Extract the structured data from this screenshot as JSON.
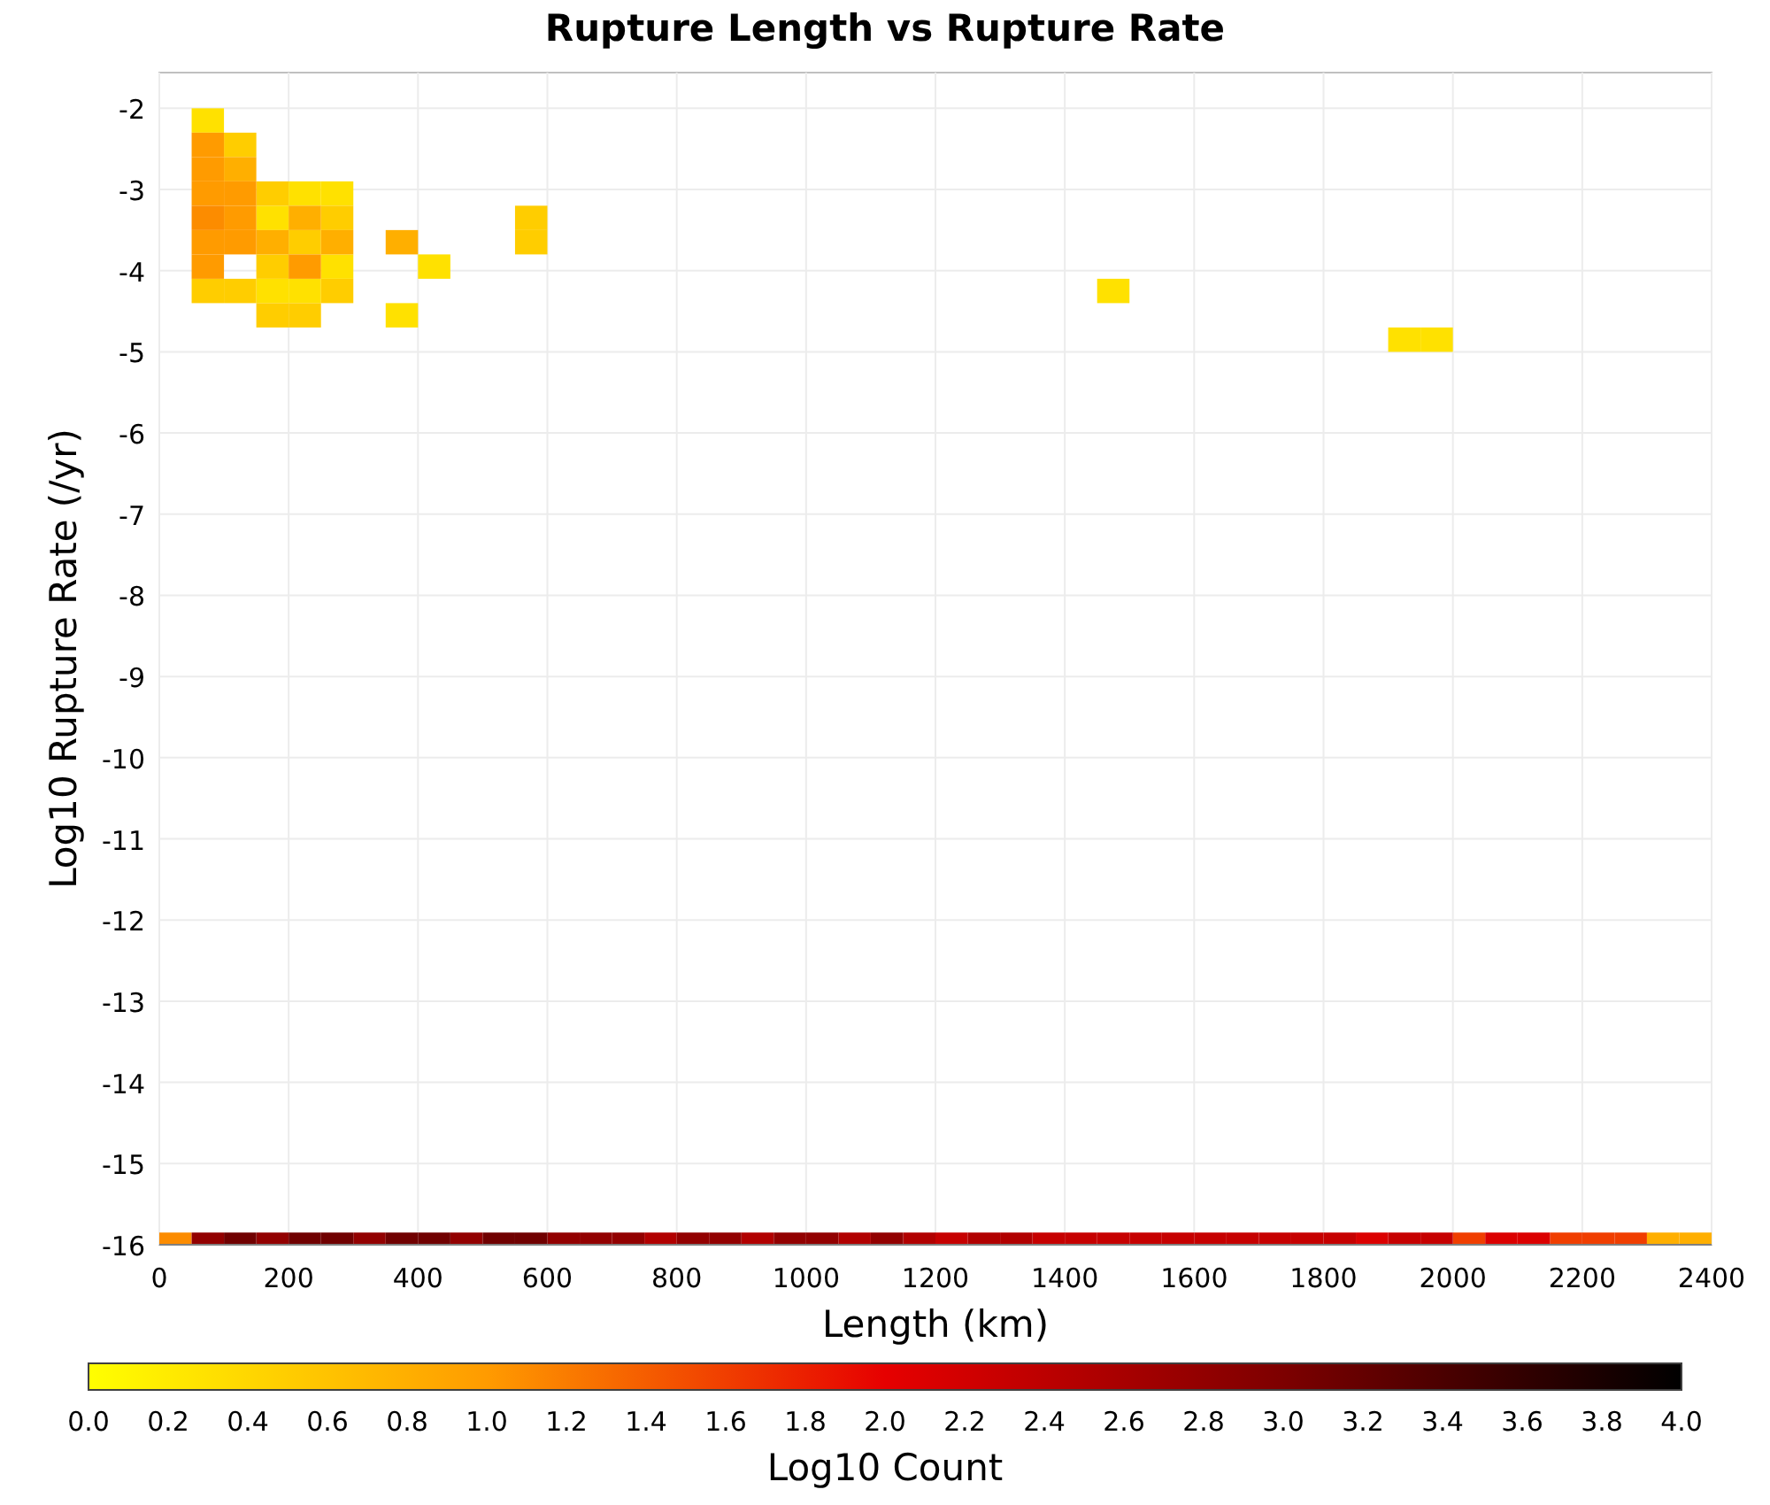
{
  "chart_data": {
    "type": "scatter",
    "title": "Rupture Length vs Rupture Rate",
    "xlabel": "Length (km)",
    "ylabel": "Log10 Rupture Rate (/yr)",
    "xlim": [
      0,
      2400
    ],
    "ylim": [
      -16,
      -1.56
    ],
    "grid": true,
    "xticks": [
      0,
      200,
      400,
      600,
      800,
      1000,
      1200,
      1400,
      1600,
      1800,
      2000,
      2200,
      2400
    ],
    "yticks": [
      -2,
      -3,
      -4,
      -5,
      -6,
      -7,
      -8,
      -9,
      -10,
      -11,
      -12,
      -13,
      -14,
      -15,
      -16
    ],
    "x": [
      75,
      225,
      275,
      175,
      275,
      425,
      175,
      225,
      1475,
      375,
      1925,
      1975,
      125,
      175,
      275,
      575,
      575,
      75,
      125,
      275,
      175,
      225,
      225,
      175,
      125,
      225,
      175,
      275,
      375,
      2325,
      2375,
      75,
      75,
      75,
      125,
      125,
      75,
      125,
      75,
      225,
      75,
      25,
      2025,
      2175,
      2225,
      2275,
      1875,
      2075,
      2125,
      1225,
      1375,
      1425,
      1475,
      1525,
      1575,
      1625,
      1675,
      1725,
      1775,
      1825,
      1925,
      1975,
      925,
      1075,
      1175,
      1275,
      1325,
      775,
      625,
      975,
      1125,
      675,
      725,
      825,
      875,
      475,
      175,
      1025,
      325,
      75,
      125,
      225,
      275,
      375,
      425,
      525,
      575
    ],
    "series": [
      {
        "color": "#ffe100",
        "values": [
          -2.15,
          -3.05,
          -3.05,
          -3.35,
          -3.95,
          -3.95,
          -4.25,
          -4.25,
          -4.25,
          -4.55,
          -4.85,
          -4.85,
          null,
          null,
          null,
          null,
          null,
          null,
          null,
          null,
          null,
          null,
          null,
          null,
          null,
          null,
          null,
          null,
          null,
          null,
          null,
          null,
          null,
          null,
          null,
          null,
          null,
          null,
          null,
          null,
          null,
          null,
          null,
          null,
          null,
          null,
          null,
          null,
          null,
          null,
          null,
          null,
          null,
          null,
          null,
          null,
          null,
          null,
          null,
          null,
          null,
          null,
          null,
          null,
          null,
          null,
          null,
          null,
          null,
          null,
          null,
          null,
          null,
          null,
          null,
          null,
          null,
          null,
          null,
          null,
          null,
          null,
          null,
          null,
          null,
          null,
          null
        ]
      },
      {
        "color": "#ffcd00",
        "values": [
          null,
          null,
          null,
          null,
          null,
          null,
          null,
          null,
          null,
          null,
          null,
          null,
          -2.45,
          -3.05,
          -3.35,
          -3.35,
          -3.65,
          -4.25,
          -4.25,
          -4.25,
          -4.55,
          -4.55,
          -3.65,
          -3.95,
          null,
          null,
          null,
          null,
          null,
          null,
          null,
          null,
          null,
          null,
          null,
          null,
          null,
          null,
          null,
          null,
          null,
          null,
          null,
          null,
          null,
          null,
          null,
          null,
          null,
          null,
          null,
          null,
          null,
          null,
          null,
          null,
          null,
          null,
          null,
          null,
          null,
          null,
          null,
          null,
          null,
          null,
          null,
          null,
          null,
          null,
          null,
          null,
          null,
          null,
          null,
          null,
          null,
          null,
          null,
          null,
          null,
          null,
          null,
          null,
          null,
          null,
          null
        ]
      },
      {
        "color": "#ffaf00",
        "values": [
          null,
          null,
          null,
          null,
          null,
          null,
          null,
          null,
          null,
          null,
          null,
          null,
          null,
          null,
          null,
          null,
          null,
          null,
          null,
          null,
          null,
          null,
          null,
          null,
          -2.75,
          -3.35,
          -3.65,
          -3.65,
          -3.65,
          -16,
          -16,
          null,
          null,
          null,
          null,
          null,
          null,
          null,
          null,
          null,
          null,
          null,
          null,
          null,
          null,
          null,
          null,
          null,
          null,
          null,
          null,
          null,
          null,
          null,
          null,
          null,
          null,
          null,
          null,
          null,
          null,
          null,
          null,
          null,
          null,
          null,
          null,
          null,
          null,
          null,
          null,
          null,
          null,
          null,
          null,
          null,
          null,
          null,
          null,
          null,
          null,
          null,
          null,
          null,
          null,
          null,
          null
        ]
      },
      {
        "color": "#ff9b00",
        "values": [
          null,
          null,
          null,
          null,
          null,
          null,
          null,
          null,
          null,
          null,
          null,
          null,
          null,
          null,
          null,
          null,
          null,
          null,
          null,
          null,
          null,
          null,
          null,
          null,
          null,
          null,
          null,
          null,
          null,
          null,
          null,
          -2.45,
          -2.75,
          -3.05,
          -3.05,
          -3.35,
          -3.65,
          -3.65,
          -3.95,
          -3.95,
          null,
          null,
          null,
          null,
          null,
          null,
          null,
          null,
          null,
          null,
          null,
          null,
          null,
          null,
          null,
          null,
          null,
          null,
          null,
          null,
          null,
          null,
          null,
          null,
          null,
          null,
          null,
          null,
          null,
          null,
          null,
          null,
          null,
          null,
          null,
          null,
          null,
          null,
          null,
          null,
          null,
          null,
          null,
          null,
          null,
          null,
          null
        ]
      },
      {
        "color": "#fc8c00",
        "values": [
          null,
          null,
          null,
          null,
          null,
          null,
          null,
          null,
          null,
          null,
          null,
          null,
          null,
          null,
          null,
          null,
          null,
          null,
          null,
          null,
          null,
          null,
          null,
          null,
          null,
          null,
          null,
          null,
          null,
          null,
          null,
          null,
          null,
          null,
          null,
          null,
          null,
          null,
          null,
          null,
          -3.35,
          -16,
          null,
          null,
          null,
          null,
          null,
          null,
          null,
          null,
          null,
          null,
          null,
          null,
          null,
          null,
          null,
          null,
          null,
          null,
          null,
          null,
          null,
          null,
          null,
          null,
          null,
          null,
          null,
          null,
          null,
          null,
          null,
          null,
          null,
          null,
          null,
          null,
          null,
          null,
          null,
          null,
          null,
          null,
          null,
          null,
          null
        ]
      },
      {
        "color": "#f03e00",
        "values": [
          null,
          null,
          null,
          null,
          null,
          null,
          null,
          null,
          null,
          null,
          null,
          null,
          null,
          null,
          null,
          null,
          null,
          null,
          null,
          null,
          null,
          null,
          null,
          null,
          null,
          null,
          null,
          null,
          null,
          null,
          null,
          null,
          null,
          null,
          null,
          null,
          null,
          null,
          null,
          null,
          null,
          null,
          -16,
          -16,
          -16,
          -16,
          null,
          null,
          null,
          null,
          null,
          null,
          null,
          null,
          null,
          null,
          null,
          null,
          null,
          null,
          null,
          null,
          null,
          null,
          null,
          null,
          null,
          null,
          null,
          null,
          null,
          null,
          null,
          null,
          null,
          null,
          null,
          null,
          null,
          null,
          null,
          null,
          null,
          null,
          null,
          null,
          null
        ]
      },
      {
        "color": "#db0000",
        "values": [
          null,
          null,
          null,
          null,
          null,
          null,
          null,
          null,
          null,
          null,
          null,
          null,
          null,
          null,
          null,
          null,
          null,
          null,
          null,
          null,
          null,
          null,
          null,
          null,
          null,
          null,
          null,
          null,
          null,
          null,
          null,
          null,
          null,
          null,
          null,
          null,
          null,
          null,
          null,
          null,
          null,
          null,
          null,
          null,
          null,
          null,
          -16,
          -16,
          -16,
          null,
          null,
          null,
          null,
          null,
          null,
          null,
          null,
          null,
          null,
          null,
          null,
          null,
          null,
          null,
          null,
          null,
          null,
          null,
          null,
          null,
          null,
          null,
          null,
          null,
          null,
          null,
          null,
          null,
          null,
          null,
          null,
          null,
          null,
          null,
          null,
          null,
          null
        ]
      },
      {
        "color": "#c60000",
        "values": [
          null,
          null,
          null,
          null,
          null,
          null,
          null,
          null,
          null,
          null,
          null,
          null,
          null,
          null,
          null,
          null,
          null,
          null,
          null,
          null,
          null,
          null,
          null,
          null,
          null,
          null,
          null,
          null,
          null,
          null,
          null,
          null,
          null,
          null,
          null,
          null,
          null,
          null,
          null,
          null,
          null,
          null,
          null,
          null,
          null,
          null,
          null,
          null,
          null,
          -16,
          -16,
          -16,
          -16,
          -16,
          -16,
          -16,
          -16,
          -16,
          -16,
          -16,
          -16,
          -16,
          null,
          null,
          null,
          null,
          null,
          null,
          null,
          null,
          null,
          null,
          null,
          null,
          null,
          null,
          null,
          null,
          null,
          null,
          null,
          null,
          null,
          null,
          null,
          null,
          null
        ]
      },
      {
        "color": "#b10000",
        "values": [
          null,
          null,
          null,
          null,
          null,
          null,
          null,
          null,
          null,
          null,
          null,
          null,
          null,
          null,
          null,
          null,
          null,
          null,
          null,
          null,
          null,
          null,
          null,
          null,
          null,
          null,
          null,
          null,
          null,
          null,
          null,
          null,
          null,
          null,
          null,
          null,
          null,
          null,
          null,
          null,
          null,
          null,
          null,
          null,
          null,
          null,
          null,
          null,
          null,
          null,
          null,
          null,
          null,
          null,
          null,
          null,
          null,
          null,
          null,
          null,
          null,
          null,
          -16,
          -16,
          -16,
          -16,
          -16,
          -16,
          null,
          null,
          null,
          null,
          null,
          null,
          null,
          null,
          null,
          null,
          null,
          null,
          null,
          null,
          null,
          null,
          null,
          null,
          null
        ]
      },
      {
        "color": "#920000",
        "values": [
          null,
          null,
          null,
          null,
          null,
          null,
          null,
          null,
          null,
          null,
          null,
          null,
          null,
          null,
          null,
          null,
          null,
          null,
          null,
          null,
          null,
          null,
          null,
          null,
          null,
          null,
          null,
          null,
          null,
          null,
          null,
          null,
          null,
          null,
          null,
          null,
          null,
          null,
          null,
          null,
          null,
          null,
          null,
          null,
          null,
          null,
          null,
          null,
          null,
          null,
          null,
          null,
          null,
          null,
          null,
          null,
          null,
          null,
          null,
          null,
          null,
          null,
          null,
          null,
          null,
          null,
          null,
          null,
          -16,
          -16,
          -16,
          -16,
          -16,
          -16,
          -16,
          -16,
          -16,
          -16,
          -16,
          -16,
          null,
          null,
          null,
          null,
          null,
          null,
          null
        ]
      },
      {
        "color": "#700000",
        "values": [
          null,
          null,
          null,
          null,
          null,
          null,
          null,
          null,
          null,
          null,
          null,
          null,
          null,
          null,
          null,
          null,
          null,
          null,
          null,
          null,
          null,
          null,
          null,
          null,
          null,
          null,
          null,
          null,
          null,
          null,
          null,
          null,
          null,
          null,
          null,
          null,
          null,
          null,
          null,
          null,
          null,
          null,
          null,
          null,
          null,
          null,
          null,
          null,
          null,
          null,
          null,
          null,
          null,
          null,
          null,
          null,
          null,
          null,
          null,
          null,
          null,
          null,
          null,
          null,
          null,
          null,
          null,
          null,
          null,
          null,
          null,
          null,
          null,
          null,
          null,
          null,
          null,
          null,
          null,
          null,
          -16,
          -16,
          -16,
          -16,
          -16,
          -16,
          -16
        ]
      }
    ]
  },
  "colorbar": {
    "label": "Log10 Count",
    "ticks": [
      "0.0",
      "0.2",
      "0.4",
      "0.6",
      "0.8",
      "1.0",
      "1.2",
      "1.4",
      "1.6",
      "1.8",
      "2.0",
      "2.2",
      "2.4",
      "2.6",
      "2.8",
      "3.0",
      "3.2",
      "3.4",
      "3.6",
      "3.8",
      "4.0"
    ]
  }
}
